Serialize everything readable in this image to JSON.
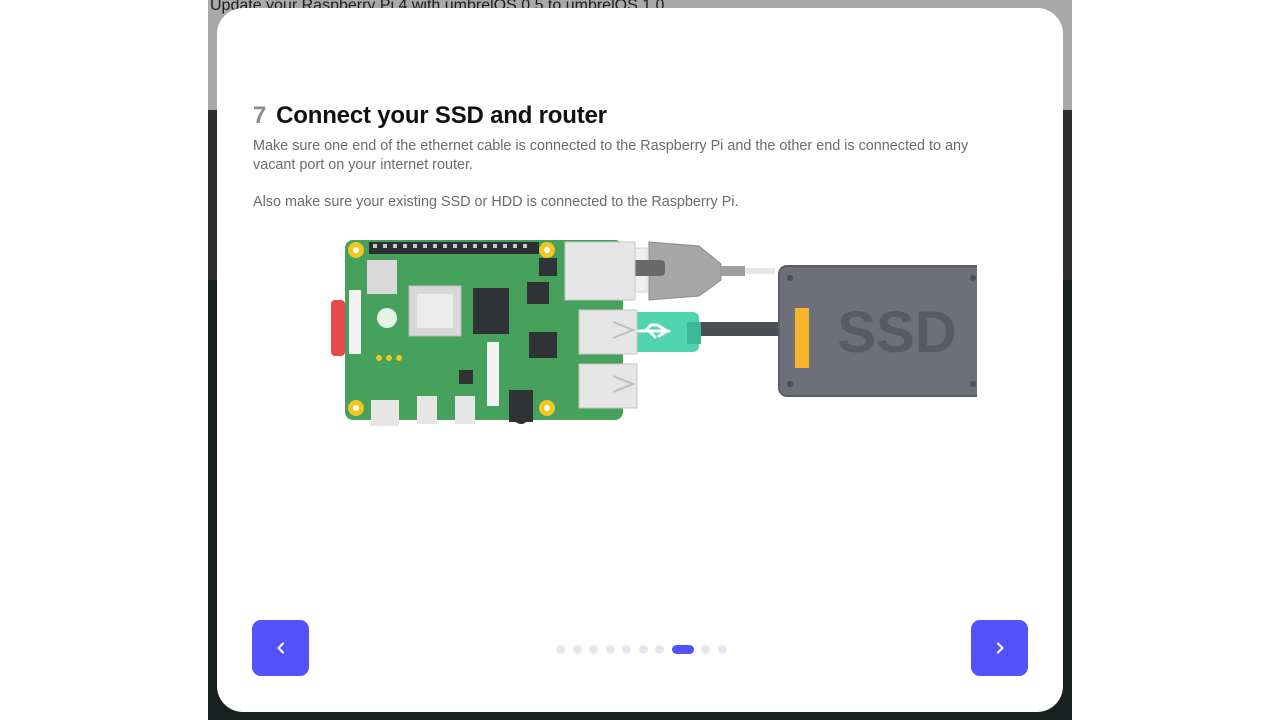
{
  "background": {
    "title": "Update your Raspberry Pi 4 with umbrelOS 0.5 to umbrelOS 1.0"
  },
  "modal": {
    "step_number": "7",
    "title": "Connect your SSD and router",
    "description_1": "Make sure one end of the ethernet cable is connected to the Raspberry Pi and the other end is connected to any vacant port on your internet router.",
    "description_2": "Also make sure your existing SSD or HDD is connected to the Raspberry Pi.",
    "illustration": {
      "ssd_label": "SSD"
    },
    "pagination": {
      "total": 11,
      "active_index": 7
    },
    "prev_icon": "chevron-left-icon",
    "next_icon": "chevron-right-icon",
    "accent_color": "#5351fb"
  }
}
